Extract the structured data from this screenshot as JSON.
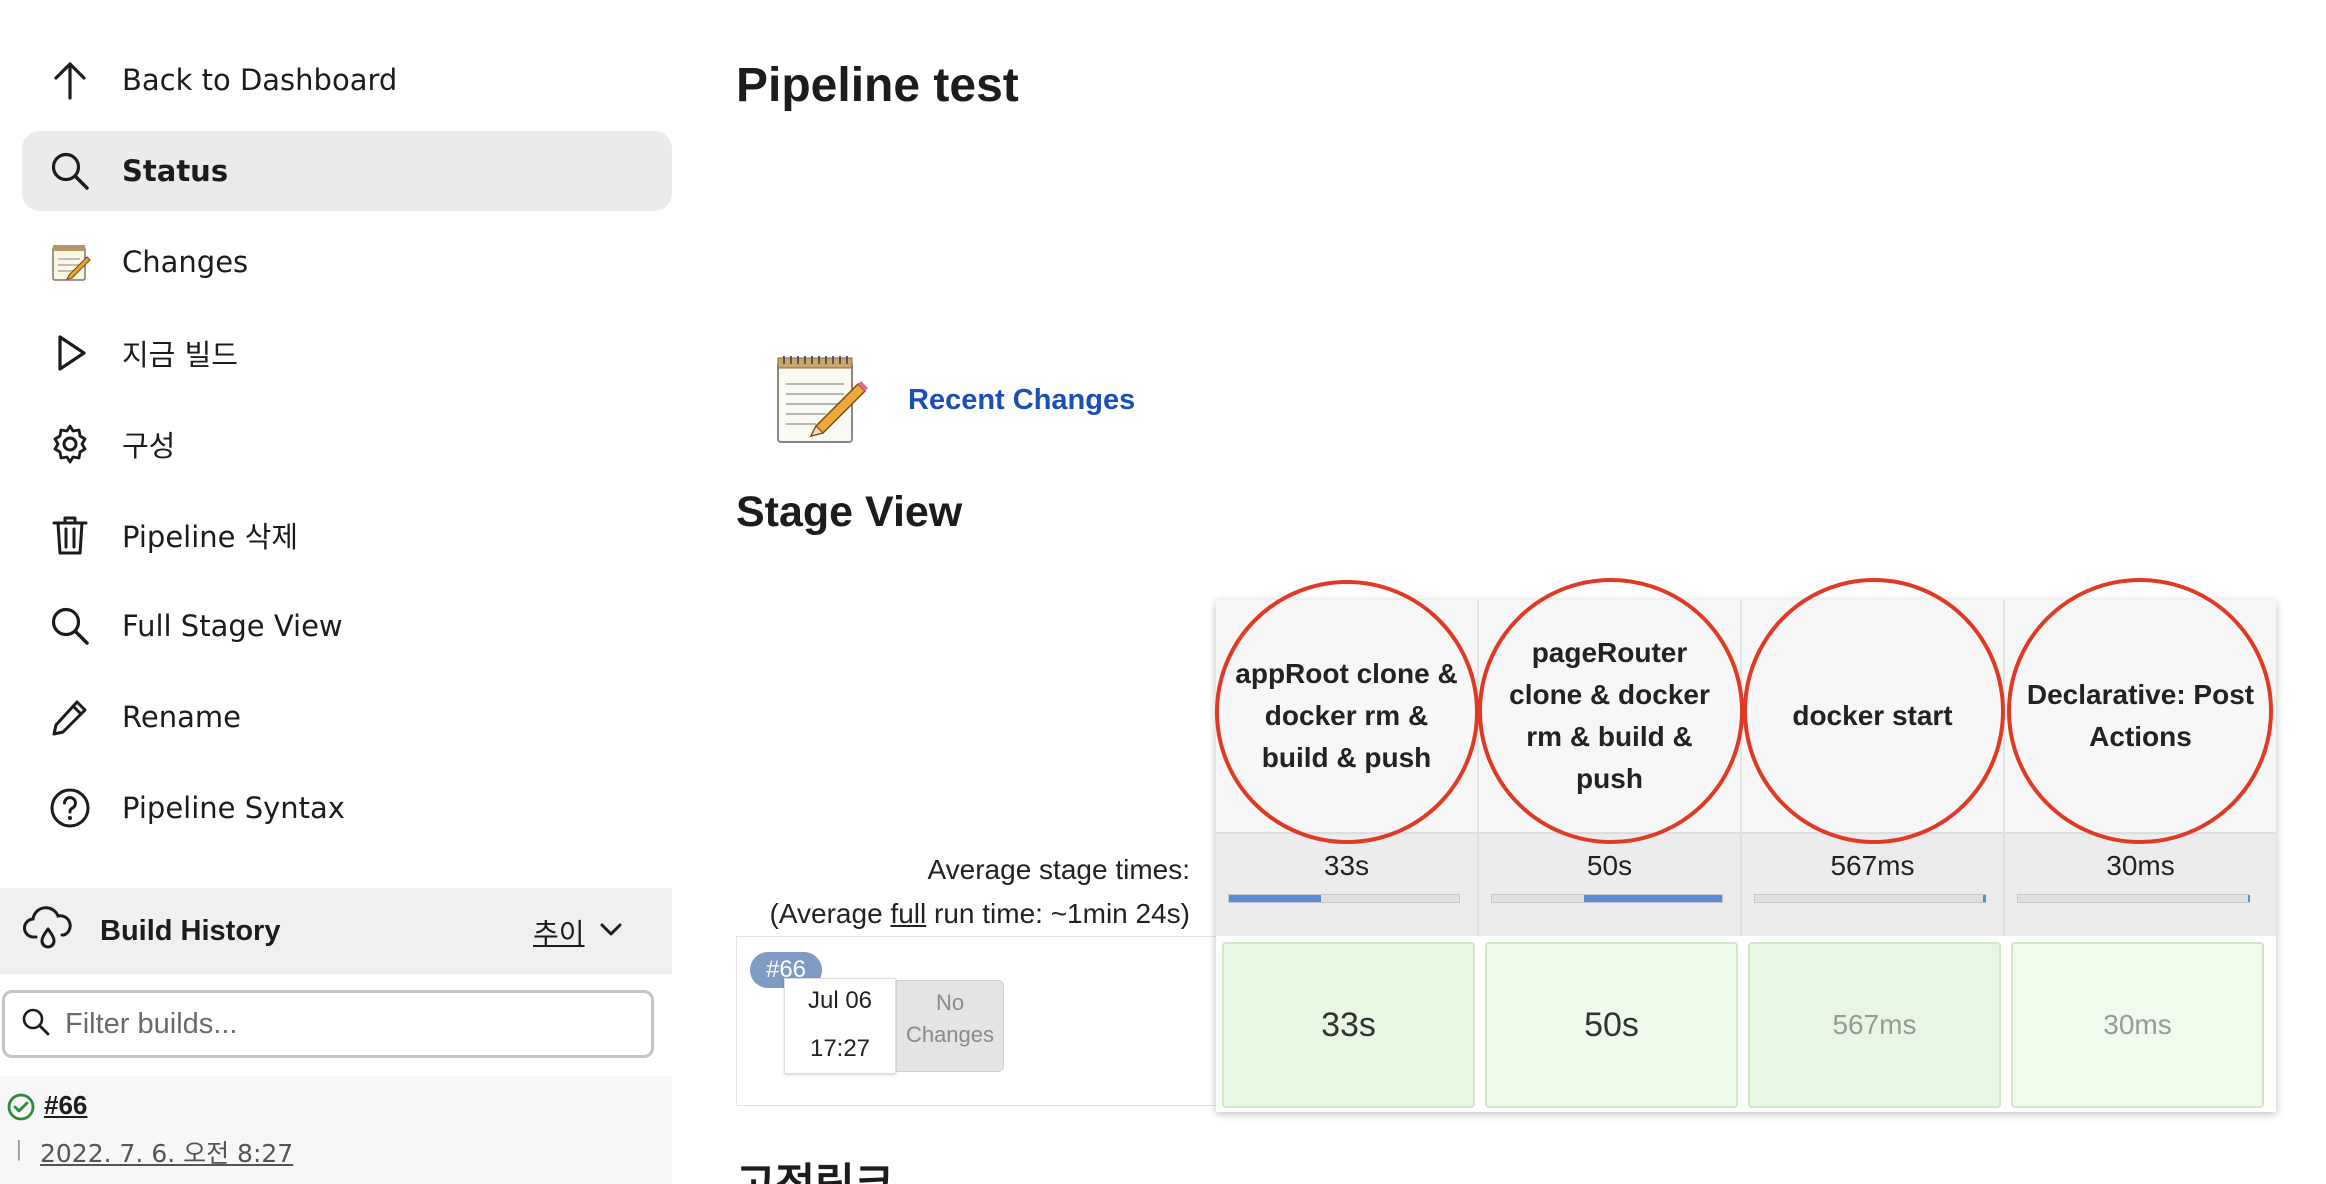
{
  "sidebar": {
    "items": [
      {
        "label": "Back to Dashboard",
        "icon": "arrow-up-icon"
      },
      {
        "label": "Status",
        "icon": "search-icon",
        "active": true
      },
      {
        "label": "Changes",
        "icon": "notepad-icon"
      },
      {
        "label": "지금 빌드",
        "icon": "play-icon"
      },
      {
        "label": "구성",
        "icon": "gear-icon"
      },
      {
        "label": "Pipeline 삭제",
        "icon": "trash-icon"
      },
      {
        "label": "Full Stage View",
        "icon": "search-icon"
      },
      {
        "label": "Rename",
        "icon": "pencil-icon"
      },
      {
        "label": "Pipeline Syntax",
        "icon": "help-circle-icon"
      }
    ],
    "build_history": {
      "title": "Build History",
      "trend_label": "추이",
      "filter_placeholder": "Filter builds...",
      "builds": [
        {
          "number": "#66",
          "date": "2022. 7. 6. 오전 8:27",
          "status": "success"
        }
      ]
    }
  },
  "main": {
    "title": "Pipeline test",
    "recent_changes": "Recent Changes",
    "stage_view_title": "Stage View",
    "avg_stage_times": "Average stage times:",
    "avg_run_prefix": "(Average ",
    "avg_run_link": "full",
    "avg_run_suffix": " run time: ~1min 24s)",
    "stages": [
      {
        "name": "appRoot clone & docker rm & build & push",
        "avg": "33s",
        "bar_fraction": 0.4
      },
      {
        "name": "pageRouter clone & docker rm & build & push",
        "avg": "50s",
        "bar_fraction": 0.6
      },
      {
        "name": "docker start",
        "avg": "567ms",
        "bar_fraction": 0.01
      },
      {
        "name": "Declarative: Post Actions",
        "avg": "30ms",
        "bar_fraction": 0.005
      }
    ],
    "run": {
      "badge": "#66",
      "date": "Jul 06",
      "time": "17:27",
      "changes": "No Changes",
      "cells": [
        "33s",
        "50s",
        "567ms",
        "30ms"
      ]
    },
    "permalinks_title": "고정링크"
  },
  "colors": {
    "accent_link": "#1a4fb8",
    "annotation_circle": "#e03a25",
    "stage_success": "#eaf7e6",
    "progress_fill": "#5a8ad8"
  }
}
